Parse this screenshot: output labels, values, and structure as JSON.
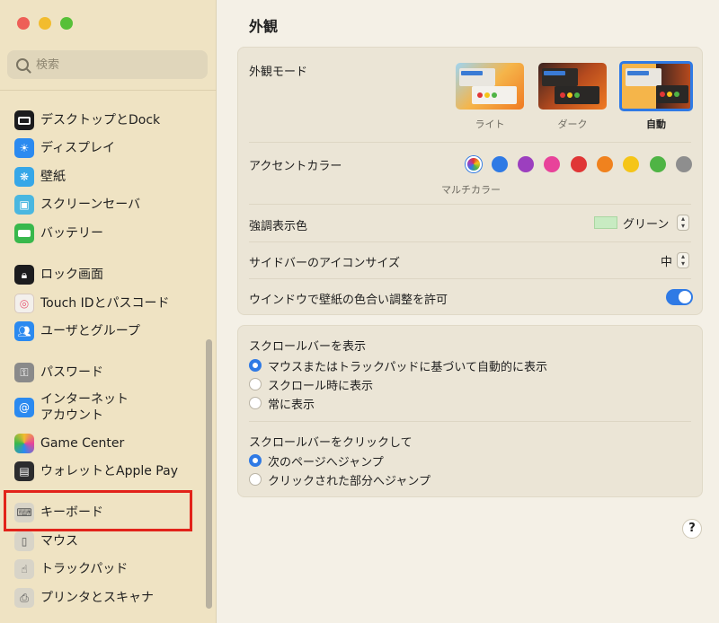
{
  "sidebar": {
    "search_placeholder": "検索",
    "items": [
      {
        "label": "デスクトップとDock"
      },
      {
        "label": "ディスプレイ"
      },
      {
        "label": "壁紙"
      },
      {
        "label": "スクリーンセーバ"
      },
      {
        "label": "バッテリー"
      },
      {
        "label": "ロック画面"
      },
      {
        "label": "Touch IDとパスコード"
      },
      {
        "label": "ユーザとグループ"
      },
      {
        "label": "パスワード"
      },
      {
        "label": "インターネット\nアカウント"
      },
      {
        "label": "Game Center"
      },
      {
        "label": "ウォレットとApple Pay"
      },
      {
        "label": "キーボード"
      },
      {
        "label": "マウス"
      },
      {
        "label": "トラックパッド"
      },
      {
        "label": "プリンタとスキャナ"
      }
    ]
  },
  "main": {
    "title": "外観",
    "appearance": {
      "label": "外観モード",
      "options": [
        {
          "label": "ライト"
        },
        {
          "label": "ダーク"
        },
        {
          "label": "自動"
        }
      ]
    },
    "accent": {
      "label": "アクセントカラー",
      "caption": "マルチカラー",
      "colors": [
        "#2f7ae5",
        "#9c3fbf",
        "#e8439a",
        "#e03636",
        "#f0821e",
        "#f5c518",
        "#4fb445",
        "#8e8e8e"
      ]
    },
    "highlight": {
      "label": "強調表示色",
      "value": "グリーン"
    },
    "icon_size": {
      "label": "サイドバーのアイコンサイズ",
      "value": "中"
    },
    "tint": {
      "label": "ウインドウで壁紙の色合い調整を許可",
      "enabled": true
    },
    "scrollbar_show": {
      "label": "スクロールバーを表示",
      "options": [
        {
          "label": "マウスまたはトラックパッドに基づいて自動的に表示",
          "selected": true
        },
        {
          "label": "スクロール時に表示",
          "selected": false
        },
        {
          "label": "常に表示",
          "selected": false
        }
      ]
    },
    "scrollbar_click": {
      "label": "スクロールバーをクリックして",
      "options": [
        {
          "label": "次のページへジャンプ",
          "selected": true
        },
        {
          "label": "クリックされた部分へジャンプ",
          "selected": false
        }
      ]
    },
    "help": "?"
  }
}
